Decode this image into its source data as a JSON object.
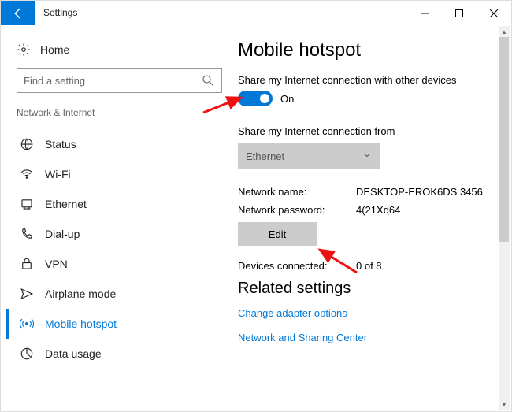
{
  "window": {
    "title": "Settings"
  },
  "sidebar": {
    "home": "Home",
    "search_placeholder": "Find a setting",
    "category": "Network & Internet",
    "items": [
      {
        "label": "Status",
        "icon": "status-icon"
      },
      {
        "label": "Wi-Fi",
        "icon": "wifi-icon"
      },
      {
        "label": "Ethernet",
        "icon": "ethernet-icon"
      },
      {
        "label": "Dial-up",
        "icon": "dialup-icon"
      },
      {
        "label": "VPN",
        "icon": "vpn-icon"
      },
      {
        "label": "Airplane mode",
        "icon": "airplane-icon"
      },
      {
        "label": "Mobile hotspot",
        "icon": "hotspot-icon",
        "active": true
      },
      {
        "label": "Data usage",
        "icon": "datausage-icon"
      }
    ]
  },
  "main": {
    "heading": "Mobile hotspot",
    "share_label": "Share my Internet connection with other devices",
    "toggle_state": "On",
    "from_label": "Share my Internet connection from",
    "from_value": "Ethernet",
    "network_name_label": "Network name:",
    "network_name_value": "DESKTOP-EROK6DS 3456",
    "network_password_label": "Network password:",
    "network_password_value": "4(21Xq64",
    "edit_label": "Edit",
    "devices_connected_label": "Devices connected:",
    "devices_connected_value": "0 of 8",
    "related_heading": "Related settings",
    "link_adapter": "Change adapter options",
    "link_sharing": "Network and Sharing Center"
  }
}
